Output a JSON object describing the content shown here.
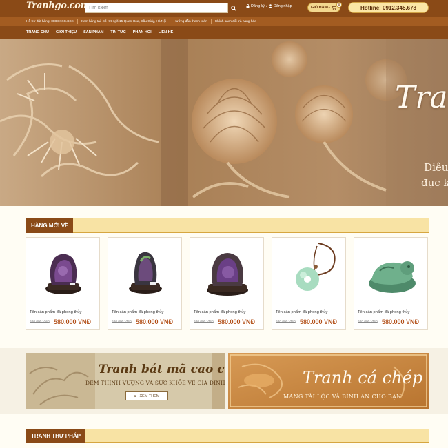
{
  "header": {
    "logo": "Tranhgo.com.vn",
    "search_placeholder": "Tìm kiếm",
    "register": "Đăng ký",
    "separator": "/",
    "login": "Đăng nhập",
    "cart_label": "GIỎ HÀNG",
    "cart_count": "0",
    "hotline": "Hotline: 0912.345.678"
  },
  "infobar": [
    "Hỗ trợ đặt hàng: 0888.XXX.XXX",
    "Xem hàng tại: Số XX ngõ 15 Quan Hoa, Cầu Giấy, Hà Nội",
    "Hướng dẫn thanh toán",
    "Chính sách đổi trả hàng hóa"
  ],
  "nav": [
    "TRANG CHỦ",
    "GIỚI THIỆU",
    "SẢN PHẨM",
    "TIN TỨC",
    "PHẢN HỒI",
    "LIÊN HỆ"
  ],
  "hero": {
    "title": "Tranh",
    "line1": "Điêu",
    "line2": "đục ke"
  },
  "new_products": {
    "heading": "HÀNG MỚI VỀ",
    "items": [
      {
        "name": "Tên sản phẩm đá phong thủy",
        "old_price": "680.000 VNĐ",
        "price": "580.000 VNĐ",
        "kind": "amethyst-geode"
      },
      {
        "name": "Tên sản phẩm đá phong thủy",
        "old_price": "680.000 VNĐ",
        "price": "580.000 VNĐ",
        "kind": "amethyst-geode"
      },
      {
        "name": "Tên sản phẩm đá phong thủy",
        "old_price": "680.000 VNĐ",
        "price": "580.000 VNĐ",
        "kind": "amethyst-geode"
      },
      {
        "name": "Tên sản phẩm đá phong thủy",
        "old_price": "680.000 VNĐ",
        "price": "580.000 VNĐ",
        "kind": "jade-pendant"
      },
      {
        "name": "Tên sản phẩm đá phong thủy",
        "old_price": "680.000 VNĐ",
        "price": "580.000 VNĐ",
        "kind": "jade-pixiu"
      }
    ]
  },
  "banners": {
    "left": {
      "title": "Tranh bát mã cao cấp",
      "subtitle": "ĐEM THỊNH VƯỢNG VÀ SỨC KHỎE VỀ GIA ĐÌNH",
      "button": "XEM THÊM"
    },
    "right": {
      "title": "Tranh cá chép",
      "subtitle": "MANG TÀI LỘC VÀ BÌNH AN CHO BẠN"
    }
  },
  "calligraphy": {
    "heading": "TRANH THƯ PHÁP"
  },
  "colors": {
    "header_brown": "#8a4a17",
    "infobar_brown": "#a35c21",
    "gold": "#f8e3a4",
    "price": "#b4531d"
  }
}
